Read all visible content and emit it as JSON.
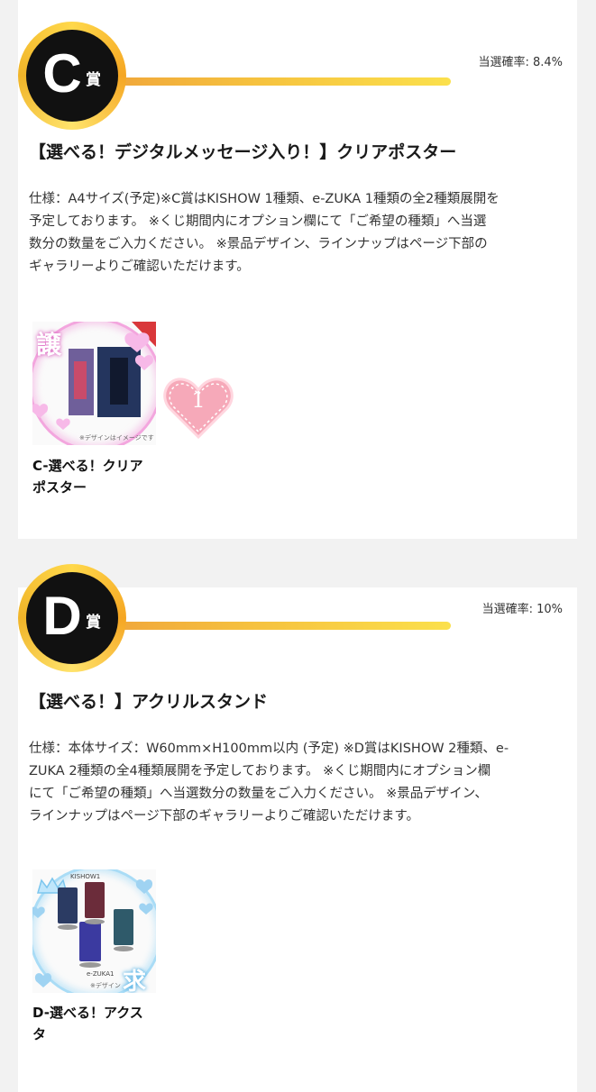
{
  "prizes": [
    {
      "letter": "C",
      "suffix": "賞",
      "probability": "当選確率: 8.4%",
      "title": "【選べる！デジタルメッセージ入り！】クリアポスター",
      "description_lines": [
        "仕様：A4サイズ(予定)※C賞はKISHOW 1種類、e-ZUKA 1種類の全2種類展開を",
        "予定しております。 ※くじ期間内にオプション欄にて「ご希望の種類」へ当選",
        "数分の数量をご入力ください。 ※景品デザイン、ラインナップはページ下部の",
        "ギャラリーよりご確認いただけます。"
      ],
      "thumb_overlay_char": "譲",
      "thumb_note": "※デザインはイメージです",
      "sticker_number": "1",
      "item_name_lines": [
        "C-選べる！クリア",
        "ポスター"
      ],
      "colors": {
        "ring": "#f3a6de",
        "heart": "#f7b9e8",
        "sticker": "#f6a9b9"
      }
    },
    {
      "letter": "D",
      "suffix": "賞",
      "probability": "当選確率: 10%",
      "title": "【選べる！】アクリルスタンド",
      "description_lines": [
        "仕様：本体サイズ：W60mm×H100mm以内 (予定) ※D賞はKISHOW 2種類、e-",
        "ZUKA 2種類の全4種類展開を予定しております。 ※くじ期間内にオプション欄",
        "にて「ご希望の種類」へ当選数分の数量をご入力ください。 ※景品デザイン、",
        "ラインナップはページ下部のギャラリーよりご確認いただけます。"
      ],
      "thumb_overlay_char": "求",
      "thumb_label_top": "KISHOW1",
      "thumb_label_bottom": "e-ZUKA1",
      "thumb_note": "※デザイン",
      "item_name_lines": [
        "D-選べる！アクス",
        "タ"
      ],
      "colors": {
        "ring": "#a9dcf6",
        "heart": "#9fd3f2"
      }
    }
  ]
}
